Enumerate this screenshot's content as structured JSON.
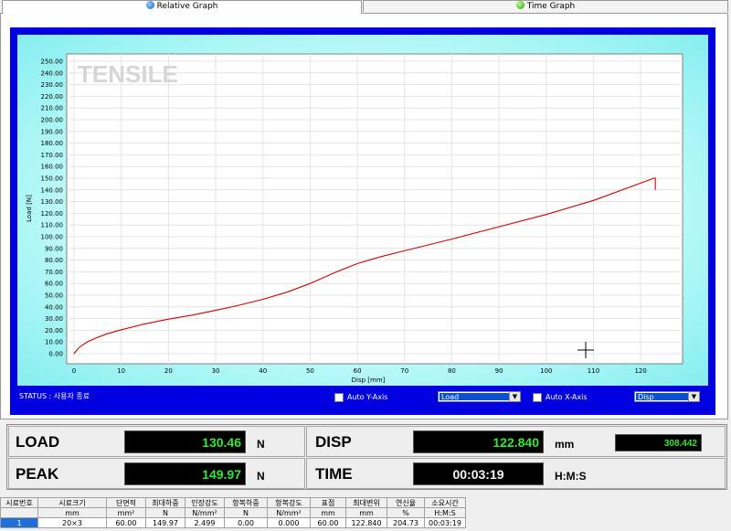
{
  "tabs": [
    {
      "label": "Relative Graph",
      "icon": "relative-graph-icon",
      "active": true
    },
    {
      "label": "Time Graph",
      "icon": "time-graph-icon",
      "active": false
    }
  ],
  "graph": {
    "watermark": "TENSILE",
    "status_text": "STATUS : 사용자 종료",
    "auto_y_label": "Auto Y-Axis",
    "auto_x_label": "Auto X-Axis",
    "y_select_value": "Load",
    "x_select_value": "Disp"
  },
  "chart_data": {
    "type": "line",
    "xlabel": "Disp [mm]",
    "ylabel": "Load [N]",
    "xlim": [
      0,
      125
    ],
    "ylim": [
      0,
      250
    ],
    "x_ticks": [
      "0",
      "10",
      "20",
      "30",
      "40",
      "50",
      "60",
      "70",
      "80",
      "90",
      "100",
      "110",
      "120"
    ],
    "y_ticks": [
      "0.00",
      "10.00",
      "20.00",
      "30.00",
      "40.00",
      "50.00",
      "60.00",
      "70.00",
      "80.00",
      "90.00",
      "100.00",
      "110.00",
      "120.00",
      "130.00",
      "140.00",
      "150.00",
      "160.00",
      "170.00",
      "180.00",
      "190.00",
      "200.00",
      "210.00",
      "220.00",
      "230.00",
      "240.00",
      "250.00"
    ],
    "grid": true,
    "line_color": "#d00000",
    "series": [
      {
        "x": [
          0,
          1,
          2,
          3,
          5,
          7,
          10,
          15,
          20,
          25,
          30,
          35,
          40,
          45,
          50,
          55,
          60,
          65,
          70,
          80,
          90,
          100,
          110,
          122.8,
          123.1,
          123.1
        ],
        "y": [
          0,
          5,
          8,
          10.5,
          14,
          17,
          20.5,
          25.5,
          29.5,
          33,
          37,
          41.5,
          46.5,
          52.5,
          60,
          69,
          77,
          83,
          88,
          98,
          108.5,
          119,
          131,
          149.97,
          149.97,
          140
        ]
      }
    ]
  },
  "readouts": {
    "load_label": "LOAD",
    "load_value": "130.46",
    "load_unit": "N",
    "disp_label": "DISP",
    "disp_value": "122.840",
    "disp_unit": "mm",
    "extra_value": "308.442",
    "peak_label": "PEAK",
    "peak_value": "149.97",
    "peak_unit": "N",
    "time_label": "TIME",
    "time_value": "00:03:19",
    "time_unit": "H:M:S"
  },
  "results_table": {
    "headers": [
      "시료번호",
      "시료크기",
      "단면적",
      "최대하중",
      "인장강도",
      "항복하중",
      "항복강도",
      "표점",
      "최대변위",
      "연신율",
      "소요시간"
    ],
    "units": [
      "",
      "mm",
      "mm²",
      "N",
      "N/mm²",
      "N",
      "N/mm²",
      "mm",
      "mm",
      "%",
      "H:M:S"
    ],
    "rows": [
      [
        "1",
        "20×3",
        "60.00",
        "149.97",
        "2.499",
        "0.00",
        "0.000",
        "60.00",
        "122.840",
        "204.73",
        "00:03:19"
      ]
    ]
  },
  "colors": {
    "accent_blue": "#0000e0",
    "lcd_green": "#32e832",
    "plot_line": "#d00000",
    "cyan_bg": "#c4fbfb"
  }
}
